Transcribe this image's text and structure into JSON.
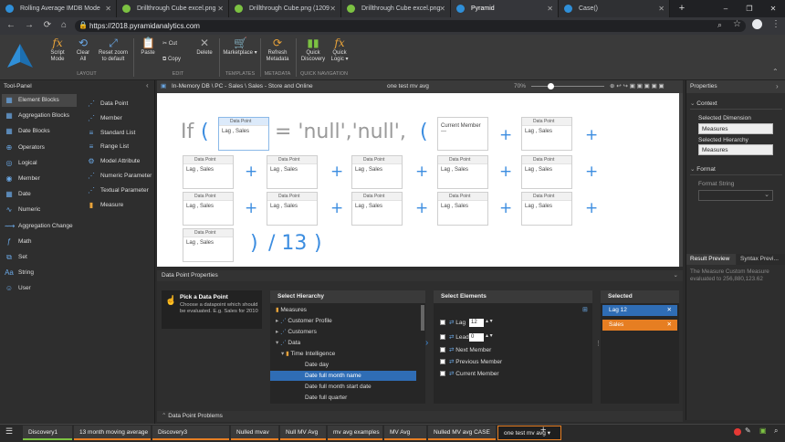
{
  "browser": {
    "tabs": [
      {
        "title": "Rolling Average IMDB Mode",
        "icon": "pyramid-icon"
      },
      {
        "title": "Drillthrough Cube excel.png",
        "icon": "image-icon"
      },
      {
        "title": "Drillthrough Cube.png (1209",
        "icon": "image-icon"
      },
      {
        "title": "Drillthrough Cube excel.png",
        "icon": "image-icon"
      },
      {
        "title": "Pyramid",
        "icon": "pyramid-icon"
      },
      {
        "title": "Case()",
        "icon": "pyramid-icon"
      }
    ],
    "url": "https://2018.pyramidanalytics.com"
  },
  "ribbon": {
    "buttons": [
      {
        "label": "Script Mode",
        "icon": "fx-icon"
      },
      {
        "label": "Clear All",
        "icon": "refresh-icon"
      },
      {
        "label": "Reset zoom to default",
        "icon": "zoom-icon"
      },
      {
        "label": "Paste",
        "icon": "paste-icon"
      },
      {
        "label": "Cut",
        "icon": "cut-icon"
      },
      {
        "label": "Copy",
        "icon": "copy-icon"
      },
      {
        "label": "Delete",
        "icon": "delete-icon"
      },
      {
        "label": "Marketplace ▾",
        "icon": "cart-icon"
      },
      {
        "label": "Refresh Metadata",
        "icon": "refresh-icon"
      },
      {
        "label": "Quick Discovery",
        "icon": "discovery-icon"
      },
      {
        "label": "Quick Logic ▾",
        "icon": "fx-icon"
      }
    ],
    "groups": [
      "LAYOUT",
      "EDIT",
      "TEMPLATES",
      "METADATA",
      "QUICK NAVIGATION"
    ]
  },
  "toolpanel": {
    "title": "Tool-Panel",
    "left_items": [
      "Element Blocks",
      "Aggregation Blocks",
      "Date Blocks",
      "Operators",
      "Logical",
      "Member",
      "Date",
      "Numeric",
      "Aggregation Change",
      "Math",
      "Set",
      "String",
      "User"
    ],
    "right_items": [
      "Data Point",
      "Member",
      "Standard List",
      "Range List",
      "Model Attribute",
      "Numeric Parameter",
      "Textual Parameter",
      "Measure"
    ]
  },
  "editor": {
    "breadcrumb": "In-Memory DB \\ PC - Sales \\ Sales - Store and Online",
    "name": "one test mv avg",
    "zoom": "70%",
    "formula": {
      "if": "If",
      "open1": "(",
      "equals": "= 'null','null',",
      "open2": "(",
      "close": ")",
      "divide": "/ 13",
      "close2": ")"
    },
    "dp_header": "Data Point",
    "dp_value": "Lag , Sales",
    "current_member": "Current Member",
    "current_member_value": "---"
  },
  "properties": {
    "title": "Properties",
    "context": "Context",
    "selected_dimension_label": "Selected Dimension",
    "selected_dimension": "Measures",
    "selected_hierarchy_label": "Selected Hierarchy",
    "selected_hierarchy": "Measures",
    "format": "Format",
    "format_string": "Format String"
  },
  "results": {
    "tab1": "Result Preview",
    "tab2": "Syntax Previ...",
    "text": "The Measure Custom Measure evaluated to 256,880,123.62"
  },
  "dpp": {
    "title": "Data Point Properties",
    "pick_title": "Pick a Data Point",
    "pick_desc": "Choose a datapoint which should be evaluated. E.g. Sales for 2010",
    "hierarchy_header": "Select Hierarchy",
    "hierarchy": [
      "Measures",
      "Customer Profile",
      "Customers",
      "Data",
      "Time Intelligence",
      "Date day",
      "Date full month name",
      "Date full month start date",
      "Date full quarter"
    ],
    "elements_header": "Select Elements",
    "elements": [
      {
        "label": "Lag",
        "value": "12",
        "checked": true
      },
      {
        "label": "Lead",
        "value": "0",
        "checked": false
      },
      {
        "label": "Next Member",
        "checked": false
      },
      {
        "label": "Previous Member",
        "checked": false
      },
      {
        "label": "Current Member",
        "checked": false
      }
    ],
    "selected_header": "Selected",
    "selected": [
      {
        "label": "Lag 12",
        "color": "#2f6db5"
      },
      {
        "label": "Sales",
        "color": "#e67e22"
      }
    ],
    "problems": "Data Point Problems"
  },
  "taskbar": {
    "tabs": [
      "Discovery1",
      "13 month moving average",
      "Discovery3",
      "Nulled mvav",
      "Null MV Avg",
      "mv avg examples",
      "MV Avg",
      "Nulled MV avg CASE",
      "one test mv avg"
    ],
    "add": "+"
  }
}
